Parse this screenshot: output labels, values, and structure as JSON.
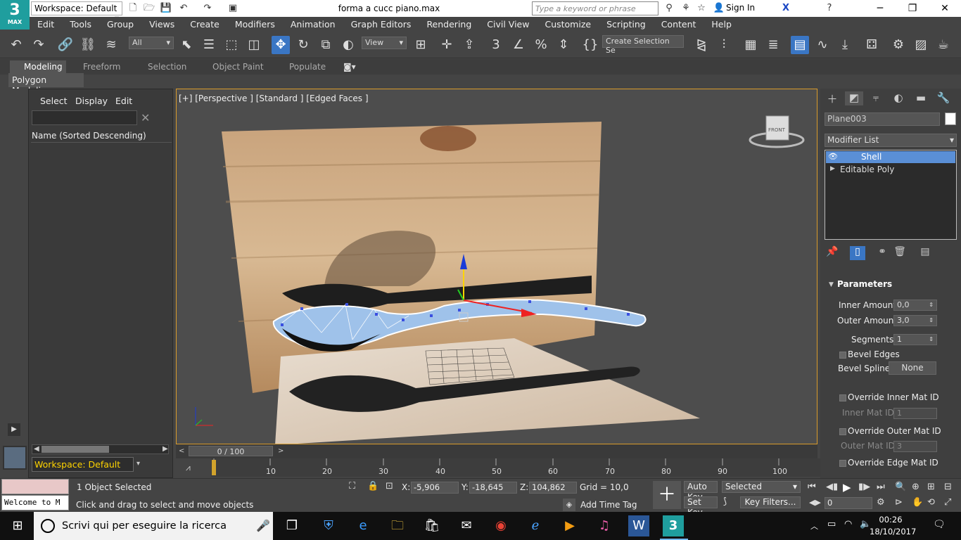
{
  "app": {
    "logo_main": "3",
    "logo_sub": "MAX",
    "workspace": "Workspace: Default",
    "title": "forma a cucc piano.max"
  },
  "search": {
    "placeholder": "Type a keyword or phrase"
  },
  "signin": "Sign In",
  "menu": [
    "Edit",
    "Tools",
    "Group",
    "Views",
    "Create",
    "Modifiers",
    "Animation",
    "Graph Editors",
    "Rendering",
    "Civil View",
    "Customize",
    "Scripting",
    "Content",
    "Help"
  ],
  "toolbar": {
    "filter": "All",
    "refcoord": "View",
    "selset": "Create Selection Se"
  },
  "ribbon": {
    "tabs": [
      "Modeling",
      "Freeform",
      "Selection",
      "Object Paint",
      "Populate"
    ],
    "sub": "Polygon Modeling"
  },
  "scene": {
    "tabs": [
      "Select",
      "Display",
      "Edit"
    ],
    "header": "Name (Sorted Descending)",
    "workspace": "Workspace: Default"
  },
  "viewport": {
    "label": "[+] [Perspective ] [Standard ] [Edged Faces ]",
    "viewcube": "FRONT"
  },
  "panel": {
    "object_name": "Plane003",
    "modifier_list": "Modifier List",
    "stack": [
      "Shell",
      "Editable Poly"
    ],
    "params_title": "Parameters",
    "inner_amount_label": "Inner Amount:",
    "inner_amount": "0,0",
    "outer_amount_label": "Outer Amount:",
    "outer_amount": "3,0",
    "segments_label": "Segments:",
    "segments": "1",
    "bevel_edges": "Bevel Edges",
    "bevel_spline_label": "Bevel Spline:",
    "bevel_spline": "None",
    "override_inner": "Override Inner Mat ID",
    "inner_mat_label": "Inner Mat ID:",
    "inner_mat": "1",
    "override_outer": "Override Outer Mat ID",
    "outer_mat_label": "Outer Mat ID:",
    "outer_mat": "3",
    "override_edge": "Override Edge Mat ID"
  },
  "timeline": {
    "slider": "0 / 100",
    "ticks": [
      "10",
      "20",
      "30",
      "40",
      "50",
      "60",
      "70",
      "80",
      "90",
      "100"
    ]
  },
  "status": {
    "selected": "1 Object Selected",
    "prompt": "Click and drag to select and move objects",
    "welcome": "Welcome to M",
    "x_label": "X:",
    "x": "-5,906",
    "y_label": "Y:",
    "y": "-18,645",
    "z_label": "Z:",
    "z": "104,862",
    "grid": "Grid = 10,0",
    "add_time_tag": "Add Time Tag",
    "auto_key": "Auto Key",
    "set_key": "Set Key",
    "key_mode": "Selected",
    "key_filters": "Key Filters...",
    "frame": "0"
  },
  "taskbar": {
    "search": "Scrivi qui per eseguire la ricerca",
    "time": "00:26",
    "date": "18/10/2017"
  }
}
